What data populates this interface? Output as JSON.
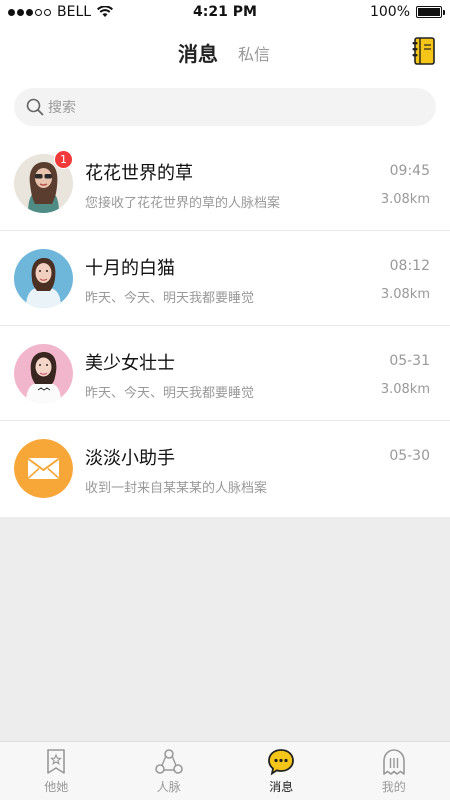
{
  "status_bar": {
    "carrier": "BELL",
    "time": "4:21 PM",
    "battery": "100%",
    "battery_level": 1.0
  },
  "header": {
    "title": "消息",
    "secondary_tab": "私信",
    "notebook_icon": "notebook-icon",
    "accent_color": "#f5c518"
  },
  "search": {
    "placeholder": "搜索"
  },
  "messages": [
    {
      "name": "花花世界的草",
      "time": "09:45",
      "preview": "您接收了花花世界的草的人脉档案",
      "distance": "3.08km",
      "badge": "1",
      "avatar": "photo-avatar-woman-sunglasses"
    },
    {
      "name": "十月的白猫",
      "time": "08:12",
      "preview": "昨天、今天、明天我都要睡觉",
      "distance": "3.08km",
      "avatar": "photo-avatar-woman-blue-bg"
    },
    {
      "name": "美少女壮士",
      "time": "05-31",
      "preview": "昨天、今天、明天我都要睡觉",
      "distance": "3.08km",
      "avatar": "photo-avatar-woman-pink-bg"
    },
    {
      "name": "淡淡小助手",
      "time": "05-30",
      "preview": "收到一封来自某某某的人脉档案",
      "avatar": "mail-icon",
      "avatar_color": "#f7a638"
    }
  ],
  "tabbar": {
    "tabs": [
      {
        "label": "他她",
        "icon": "bookmark-star-icon",
        "active": false
      },
      {
        "label": "人脉",
        "icon": "network-icon",
        "active": false
      },
      {
        "label": "消息",
        "icon": "chat-bubble-icon",
        "active": true
      },
      {
        "label": "我的",
        "icon": "ghost-icon",
        "active": false
      }
    ]
  }
}
